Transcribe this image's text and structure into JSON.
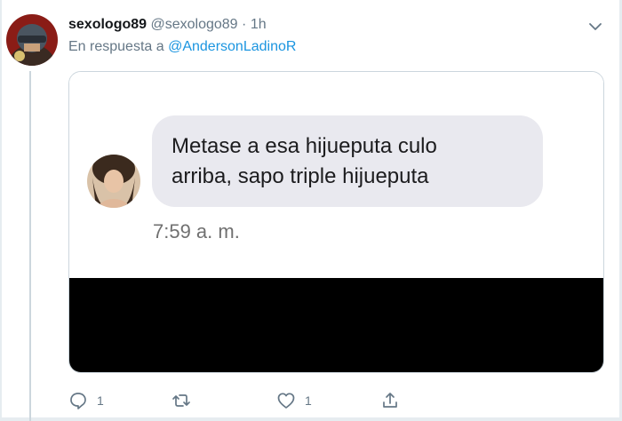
{
  "tweet": {
    "display_name": "sexologo89",
    "handle": "@sexologo89",
    "separator": "·",
    "time": "1h",
    "reply_prefix": "En respuesta a",
    "reply_user": "@AndersonLadinoR"
  },
  "media": {
    "message_line1": "Metase a esa hijueputa culo",
    "message_line2": "arriba, sapo triple hijueputa",
    "message_time": "7:59 a. m."
  },
  "actions": {
    "reply_count": "1",
    "like_count": "1"
  },
  "colors": {
    "accent": "#1b95e0",
    "muted": "#657786",
    "bubble": "#e9e9ef"
  }
}
